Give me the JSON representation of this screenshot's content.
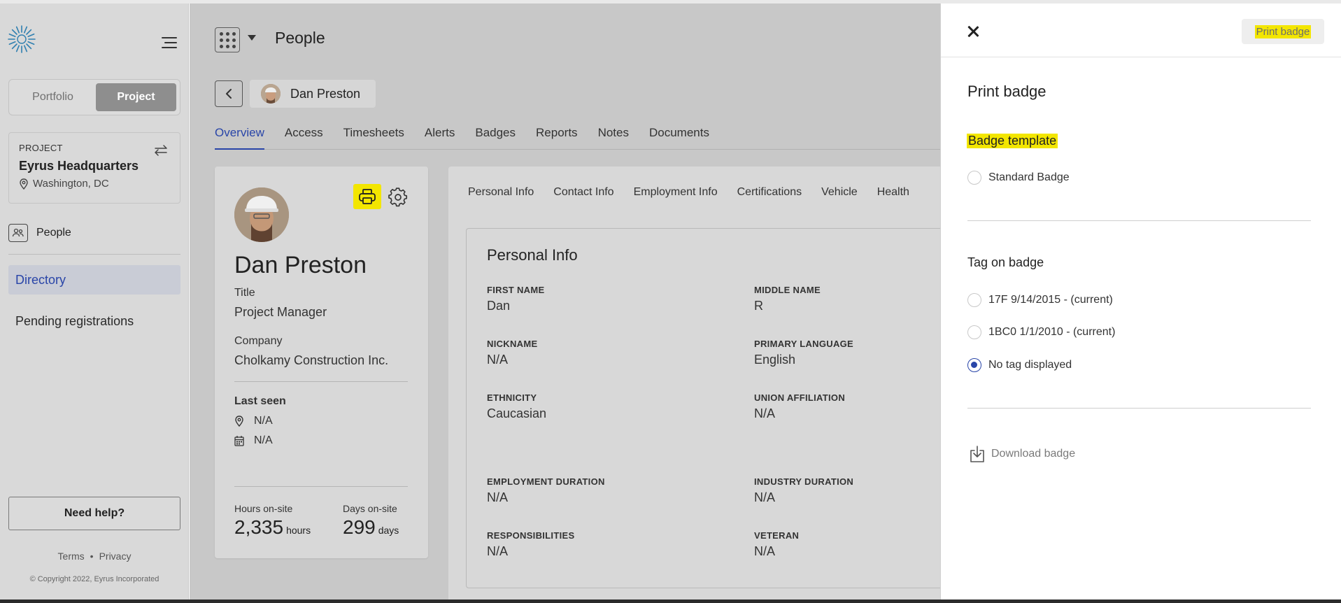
{
  "sidebar": {
    "scope_toggle": {
      "portfolio": "Portfolio",
      "project": "Project"
    },
    "project_card": {
      "label": "PROJECT",
      "name": "Eyrus Headquarters",
      "location": "Washington, DC"
    },
    "section": "People",
    "nav": {
      "directory": "Directory",
      "pending": "Pending registrations"
    },
    "help": "Need help?",
    "footer": {
      "terms": "Terms",
      "separator": "•",
      "privacy": "Privacy",
      "copyright": "© Copyright 2022, Eyrus Incorporated"
    }
  },
  "header": {
    "title": "People"
  },
  "person": {
    "chip_name": "Dan Preston",
    "name": "Dan Preston",
    "title_label": "Title",
    "title": "Project Manager",
    "company_label": "Company",
    "company": "Cholkamy Construction Inc.",
    "last_seen_label": "Last seen",
    "last_seen_location": "N/A",
    "last_seen_time": "N/A",
    "hours_label": "Hours on-site",
    "hours_value": "2,335",
    "hours_unit": "hours",
    "days_label": "Days on-site",
    "days_value": "299",
    "days_unit": "days"
  },
  "tabs": [
    "Overview",
    "Access",
    "Timesheets",
    "Alerts",
    "Badges",
    "Reports",
    "Notes",
    "Documents"
  ],
  "subtabs": [
    "Personal Info",
    "Contact Info",
    "Employment Info",
    "Certifications",
    "Vehicle",
    "Health"
  ],
  "personal_info": {
    "title": "Personal Info",
    "first_name": {
      "label": "FIRST NAME",
      "value": "Dan"
    },
    "middle_name": {
      "label": "MIDDLE NAME",
      "value": "R"
    },
    "nickname": {
      "label": "NICKNAME",
      "value": "N/A"
    },
    "primary_language": {
      "label": "PRIMARY LANGUAGE",
      "value": "English"
    },
    "ethnicity": {
      "label": "ETHNICITY",
      "value": "Caucasian"
    },
    "union_affiliation": {
      "label": "UNION AFFILIATION",
      "value": "N/A"
    },
    "employment_duration": {
      "label": "EMPLOYMENT DURATION",
      "value": "N/A"
    },
    "industry_duration": {
      "label": "INDUSTRY DURATION",
      "value": "N/A"
    },
    "responsibilities": {
      "label": "RESPONSIBILITIES",
      "value": "N/A"
    },
    "veteran": {
      "label": "VETERAN",
      "value": "N/A"
    }
  },
  "panel": {
    "print_button": "Print badge",
    "title": "Print badge",
    "badge_template_heading": "Badge template",
    "badge_template_option": "Standard Badge",
    "tag_heading": "Tag on badge",
    "tag_options": [
      "17F 9/14/2015 - (current)",
      "1BC0 1/1/2010 - (current)",
      "No tag displayed"
    ],
    "tag_selected": "No tag displayed",
    "download": "Download badge"
  },
  "colors": {
    "accent": "#2945a8",
    "highlight": "#f3e600",
    "overlay": "#c8c8c8"
  }
}
